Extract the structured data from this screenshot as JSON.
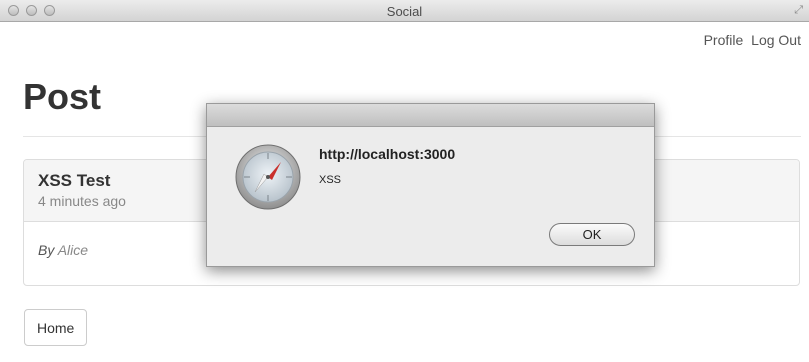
{
  "window": {
    "title": "Social"
  },
  "nav": {
    "profile": "Profile",
    "logout": "Log Out"
  },
  "page": {
    "title": "Post"
  },
  "post": {
    "title": "XSS Test",
    "time": "4 minutes ago",
    "by": "By",
    "author": "Alice"
  },
  "home_button": "Home",
  "alert": {
    "title": "http://localhost:3000",
    "message": "XSS",
    "ok": "OK"
  },
  "icons": {
    "alert_icon": "safari-compass-icon",
    "resize": "fullscreen-arrows-icon"
  }
}
